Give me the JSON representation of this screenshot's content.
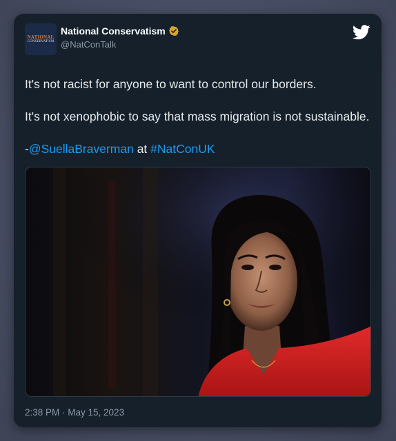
{
  "account": {
    "display_name": "National Conservatism",
    "handle": "@NatConTalk",
    "avatar_text_top": "NATIONAL",
    "avatar_text_bottom": "CONSERVATISM",
    "verified": true,
    "verified_color": "#d7a52f"
  },
  "tweet": {
    "line1": "It's not racist for anyone to want to control our borders.",
    "line2": "It's not xenophobic to say that mass migration is not sustainable.",
    "attribution_prefix": "-",
    "mention": "@SuellaBraverman",
    "at_word": " at ",
    "hashtag": "#NatConUK",
    "timestamp": "2:38 PM · May 15, 2023"
  },
  "colors": {
    "card_background": "#15202b",
    "link": "#1d9bf0",
    "text": "#e7e9ea",
    "muted": "#8b98a5",
    "twitter_icon": "#ffffff"
  },
  "icons": {
    "brand": "twitter-bird-icon",
    "verified": "verified-badge-icon"
  }
}
